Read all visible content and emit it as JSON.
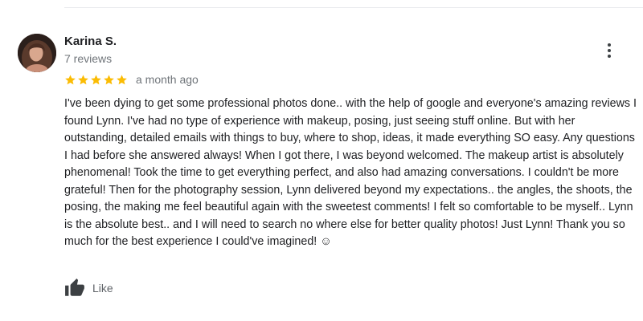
{
  "review": {
    "author": {
      "name": "Karina S.",
      "review_count": "7 reviews"
    },
    "rating": 5,
    "rating_max": 5,
    "star_color": "#fbbc04",
    "date": "a month ago",
    "text": "I've been dying to get some professional photos done.. with the help of google and everyone's amazing reviews I found Lynn. I've had no type of experience with makeup, posing, just seeing stuff online. But with her outstanding, detailed emails with things to buy, where to shop, ideas, it made everything SO easy. Any questions I had before she answered always! When I got there, I was beyond welcomed. The makeup artist is absolutely phenomenal! Took the time to get everything perfect, and also had amazing conversations. I couldn't be more grateful! Then for the photography session, Lynn delivered beyond my expectations.. the angles, the shoots, the posing, the making me feel beautiful again with the sweetest comments! I felt so comfortable to be myself.. Lynn is the absolute best.. and I will need to search no where else for better quality photos! Just Lynn! Thank you so much for the best experience I could've imagined! ☺",
    "actions": {
      "like_label": "Like",
      "like_icon": "thumbs-up-icon",
      "more_icon": "more-vertical-icon"
    }
  }
}
